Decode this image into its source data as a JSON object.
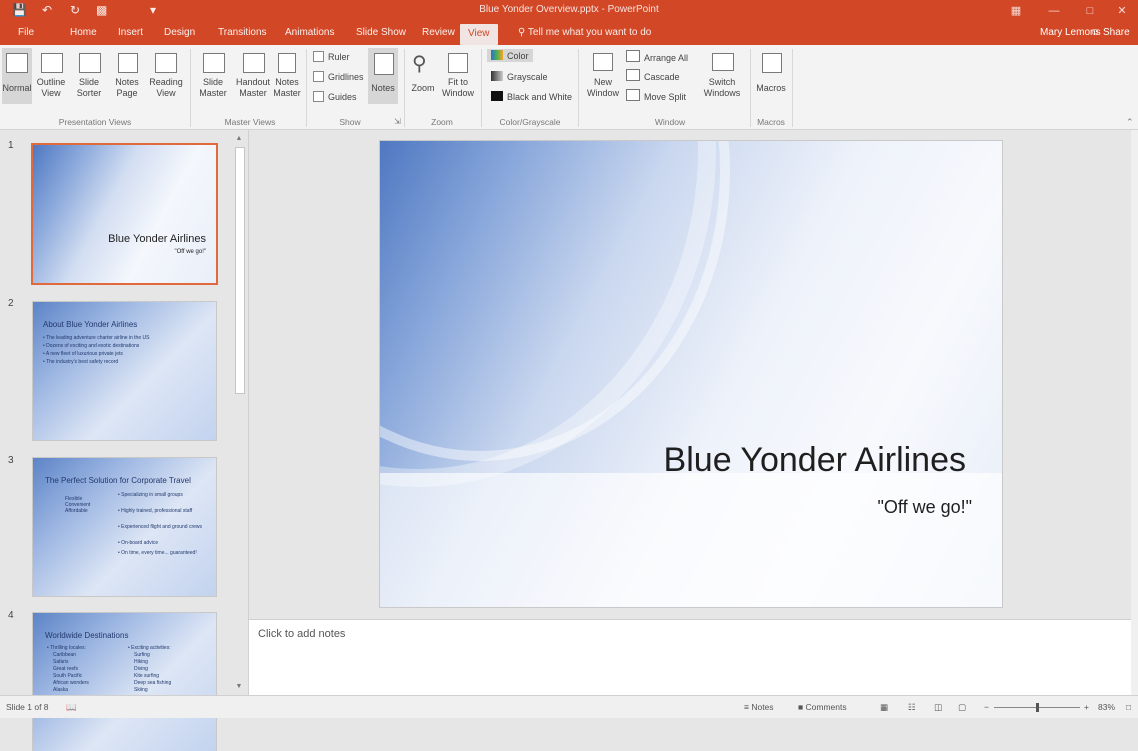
{
  "window": {
    "title": "Blue Yonder Overview.pptx - PowerPoint",
    "quick_access": [
      "save",
      "undo",
      "redo",
      "present",
      "customize"
    ]
  },
  "tabs": [
    "File",
    "Home",
    "Insert",
    "Design",
    "Transitions",
    "Animations",
    "Slide Show",
    "Review",
    "View"
  ],
  "active_tab": "View",
  "tell_me": "Tell me what you want to do",
  "user": "Mary Lemons",
  "share": "Share",
  "ribbon": {
    "presentation_views": {
      "label": "Presentation Views",
      "buttons": [
        "Normal",
        "Outline View",
        "Slide Sorter",
        "Notes Page",
        "Reading View"
      ]
    },
    "master_views": {
      "label": "Master Views",
      "buttons": [
        "Slide Master",
        "Handout Master",
        "Notes Master"
      ]
    },
    "show": {
      "label": "Show",
      "checkboxes": [
        "Ruler",
        "Gridlines",
        "Guides"
      ],
      "notes": "Notes"
    },
    "zoom": {
      "label": "Zoom",
      "buttons": [
        "Zoom",
        "Fit to Window"
      ]
    },
    "color": {
      "label": "Color/Grayscale",
      "options": [
        "Color",
        "Grayscale",
        "Black and White"
      ]
    },
    "window": {
      "label": "Window",
      "new_window": "New Window",
      "items": [
        "Arrange All",
        "Cascade",
        "Move Split"
      ],
      "switch": "Switch Windows"
    },
    "macros": {
      "label": "Macros",
      "button": "Macros"
    }
  },
  "slides": [
    {
      "number": "1",
      "title": "Blue Yonder Airlines",
      "subtitle": "\"Off we go!\""
    },
    {
      "number": "2",
      "title": "About Blue Yonder Airlines",
      "bullets": [
        "The leading adventure charter airline in the US",
        "Dozens of exciting and exotic destinations",
        "A new fleet of luxurious private jets",
        "The industry's best safety record"
      ]
    },
    {
      "number": "3",
      "title": "The Perfect Solution for Corporate Travel",
      "left": [
        "Flexible",
        "Convenient",
        "Affordable"
      ],
      "bullets": [
        "Specializing in small groups",
        "Highly trained, professional staff",
        "Experienced flight and ground crews",
        "On-board advice",
        "On time, every time... guaranteed!"
      ]
    },
    {
      "number": "4",
      "title": "Worldwide Destinations",
      "col1": [
        "Thrilling locales:",
        "Caribbean",
        "Safaris",
        "Great reefs",
        "South Pacific",
        "African wonders",
        "Alaska"
      ],
      "col2": [
        "Exciting activities:",
        "Surfing",
        "Hiking",
        "Diving",
        "Kite surfing",
        "Deep sea fishing",
        "Skiing"
      ]
    }
  ],
  "main_slide": {
    "title": "Blue Yonder Airlines",
    "subtitle": "\"Off we go!\""
  },
  "notes": {
    "placeholder": "Click to add notes"
  },
  "status": {
    "slide": "Slide 1 of 8",
    "notes": "Notes",
    "comments": "Comments",
    "zoom": "83%"
  },
  "colors": {
    "accent": "#D24726",
    "ribbon": "#F3F3F3"
  }
}
